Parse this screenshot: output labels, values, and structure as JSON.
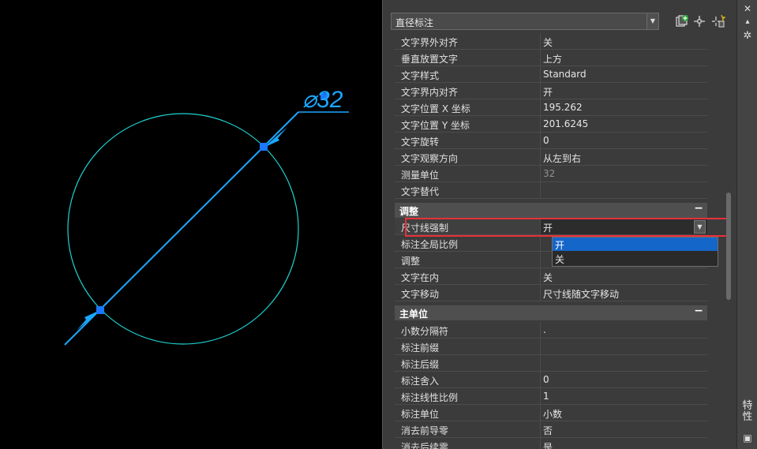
{
  "drawing": {
    "dimension_text": "⌀32",
    "colors": {
      "circle": "#1fd3d3",
      "dimension": "#1aa7ff",
      "grip": "#1a78ff"
    }
  },
  "header": {
    "object_type": "直径标注",
    "icons": [
      "quick-select-icon",
      "select-objects-icon",
      "toggle-pickadd-icon"
    ]
  },
  "rows_top": [
    {
      "name": "文字界外对齐",
      "value": "关"
    },
    {
      "name": "垂直放置文字",
      "value": "上方"
    },
    {
      "name": "文字样式",
      "value": "Standard"
    },
    {
      "name": "文字界内对齐",
      "value": "开"
    },
    {
      "name": "文字位置 X 坐标",
      "value": "195.262"
    },
    {
      "name": "文字位置 Y 坐标",
      "value": "201.6245"
    },
    {
      "name": "文字旋转",
      "value": "0"
    },
    {
      "name": "文字观察方向",
      "value": "从左到右"
    },
    {
      "name": "测量单位",
      "value": "32"
    },
    {
      "name": "文字替代",
      "value": ""
    }
  ],
  "category_adjust": {
    "title": "调整",
    "toggle": "−"
  },
  "rows_adjust": [
    {
      "name": "尺寸线强制",
      "value": "开"
    },
    {
      "name": "标注全局比例",
      "value": ""
    },
    {
      "name": "调整",
      "value": ""
    },
    {
      "name": "文字在内",
      "value": "关"
    },
    {
      "name": "文字移动",
      "value": "尺寸线随文字移动"
    }
  ],
  "dropdown_options": [
    "开",
    "关"
  ],
  "category_primary": {
    "title": "主单位",
    "toggle": "−"
  },
  "rows_primary": [
    {
      "name": "小数分隔符",
      "value": "."
    },
    {
      "name": "标注前缀",
      "value": ""
    },
    {
      "name": "标注后缀",
      "value": ""
    },
    {
      "name": "标注舍入",
      "value": "0"
    },
    {
      "name": "标注线性比例",
      "value": "1"
    },
    {
      "name": "标注单位",
      "value": "小数"
    },
    {
      "name": "消去前导零",
      "value": "否"
    },
    {
      "name": "消去后续零",
      "value": "是"
    }
  ],
  "sidebar": {
    "label": "特性"
  }
}
